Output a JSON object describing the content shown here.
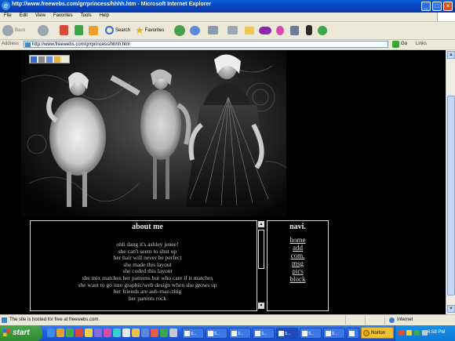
{
  "window": {
    "title": "http://www.freewebs.com/grrprincess/hhhh.htm - Microsoft Internet Explorer",
    "controls": [
      "_",
      "□",
      "×"
    ]
  },
  "menu": [
    "File",
    "Edit",
    "View",
    "Favorites",
    "Tools",
    "Help"
  ],
  "toolbar": {
    "back_label": "Back",
    "search_label": "Search",
    "favorites_label": "Favorites"
  },
  "address": {
    "label": "Address",
    "url": "http://www.freewebs.com/grrprincess/hhhh.htm",
    "go_label": "Go",
    "links_label": "Links"
  },
  "page": {
    "about": {
      "heading": "about me",
      "lines": [
        "ohh dang it's ashley jenee!",
        "she can't seem to shut up",
        "her hair will never be perfect",
        "she made this layout",
        "she coded this layout",
        "she mix matches her patterns but who care if it matches",
        "she want to go into graphic/web design when she grows up",
        "her friends are auh-maz-zing",
        "her parents rock"
      ]
    },
    "navi": {
      "heading": "navi.",
      "links": [
        "home",
        "add",
        "com.",
        "msg",
        "pics",
        "block"
      ]
    }
  },
  "status": {
    "text": "The site is hosted for free at freewebs.com.",
    "zone": "Internet"
  },
  "taskbar": {
    "start_label": "start",
    "tasks": [
      "S...",
      "S...",
      "S...",
      "S...",
      "S...",
      "S...",
      "S...",
      "S...",
      "S..."
    ],
    "norton_label": "Norton",
    "clock": "6:58 PM"
  },
  "colors": {
    "titlebar": "#0a4fc8",
    "taskbar": "#245edb",
    "start": "#2f8a2f",
    "page_bg": "#000000"
  }
}
